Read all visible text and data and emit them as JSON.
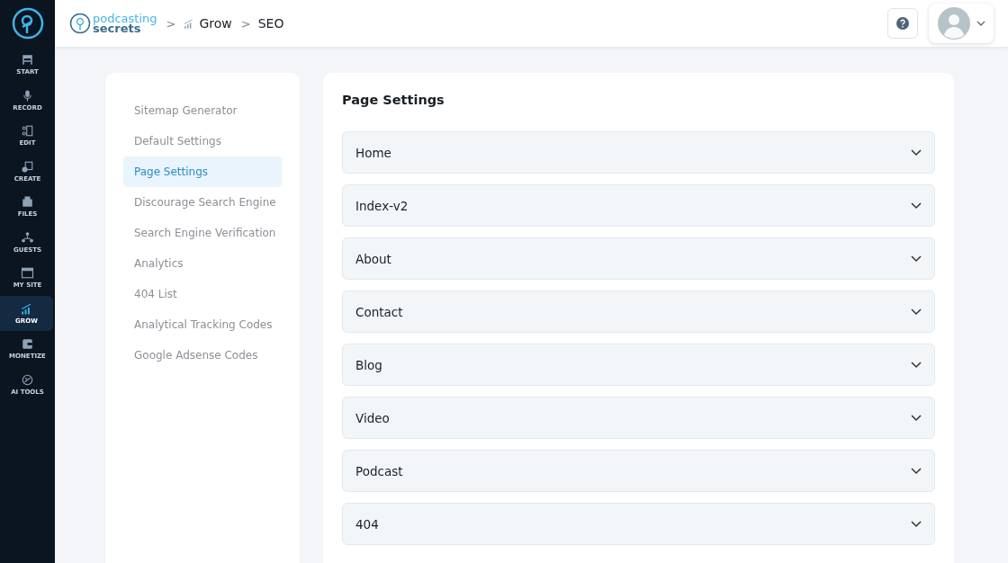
{
  "nav": [
    {
      "label": "START",
      "selected": false
    },
    {
      "label": "RECORD",
      "selected": false
    },
    {
      "label": "EDIT",
      "selected": false
    },
    {
      "label": "CREATE",
      "selected": false
    },
    {
      "label": "FILES",
      "selected": false
    },
    {
      "label": "GUESTS",
      "selected": false
    },
    {
      "label": "MY SITE",
      "selected": false
    },
    {
      "label": "GROW",
      "selected": true
    },
    {
      "label": "MONETIZE",
      "selected": false
    },
    {
      "label": "AI TOOLS",
      "selected": false
    }
  ],
  "header": {
    "logo": [
      "podcasting",
      "secrets"
    ],
    "breadcrumb": [
      "Grow",
      "SEO"
    ],
    "separator": ">"
  },
  "menu": [
    {
      "label": "Sitemap Generator",
      "selected": false
    },
    {
      "label": "Default Settings",
      "selected": false
    },
    {
      "label": "Page Settings",
      "selected": true
    },
    {
      "label": "Discourage Search Engine",
      "selected": false
    },
    {
      "label": "Search Engine Verification",
      "selected": false
    },
    {
      "label": "Analytics",
      "selected": false
    },
    {
      "label": "404 List",
      "selected": false
    },
    {
      "label": "Analytical Tracking Codes",
      "selected": false
    },
    {
      "label": "Google Adsense Codes",
      "selected": false
    }
  ],
  "page": {
    "title": "Page Settings",
    "sections": [
      {
        "label": "Home",
        "expanded": false
      },
      {
        "label": "Index-v2",
        "expanded": false
      },
      {
        "label": "About",
        "expanded": false
      },
      {
        "label": "Contact",
        "expanded": false
      },
      {
        "label": "Blog",
        "expanded": false
      },
      {
        "label": "Video",
        "expanded": false
      },
      {
        "label": "Podcast",
        "expanded": false
      },
      {
        "label": "404",
        "expanded": false
      }
    ]
  }
}
